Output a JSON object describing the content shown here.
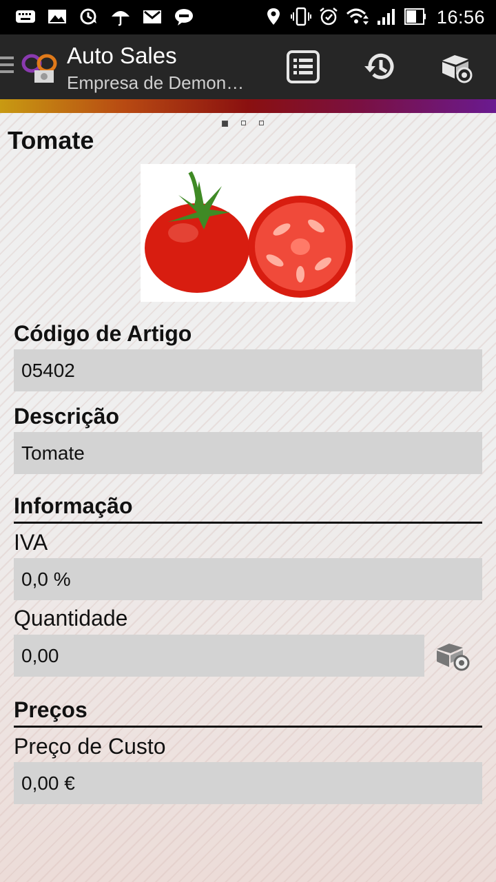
{
  "status_bar": {
    "time": "16:56",
    "left_icons": [
      "keyboard-icon",
      "image-icon",
      "sync-icon",
      "umbrella-icon",
      "gmail-icon",
      "chat-icon"
    ],
    "right_icons": [
      "location-icon",
      "vibrate-icon",
      "alarm-icon",
      "wifi-icon",
      "signal-icon",
      "battery-icon"
    ]
  },
  "app_bar": {
    "title": "Auto Sales",
    "subtitle": "Empresa de Demonstração",
    "actions": [
      "list-icon",
      "history-icon",
      "stock-icon"
    ]
  },
  "pager": {
    "count": 3,
    "active": 0
  },
  "item": {
    "name": "Tomate",
    "image": "tomato-image"
  },
  "fields": {
    "code_label": "Código de Artigo",
    "code_value": "05402",
    "description_label": "Descrição",
    "description_value": "Tomate"
  },
  "info_section": {
    "title": "Informação",
    "vat_label": "IVA",
    "vat_value": "0,0 %",
    "quantity_label": "Quantidade",
    "quantity_value": "0,00"
  },
  "prices_section": {
    "title": "Preços",
    "cost_label": "Preço de Custo",
    "cost_value": "0,00 €"
  },
  "colors": {
    "status_bar": "#000000",
    "app_bar": "#262626",
    "field_background": "#d3d3d3",
    "accent_gradient": [
      "#c89a12",
      "#8a1010",
      "#6a1a90"
    ]
  }
}
